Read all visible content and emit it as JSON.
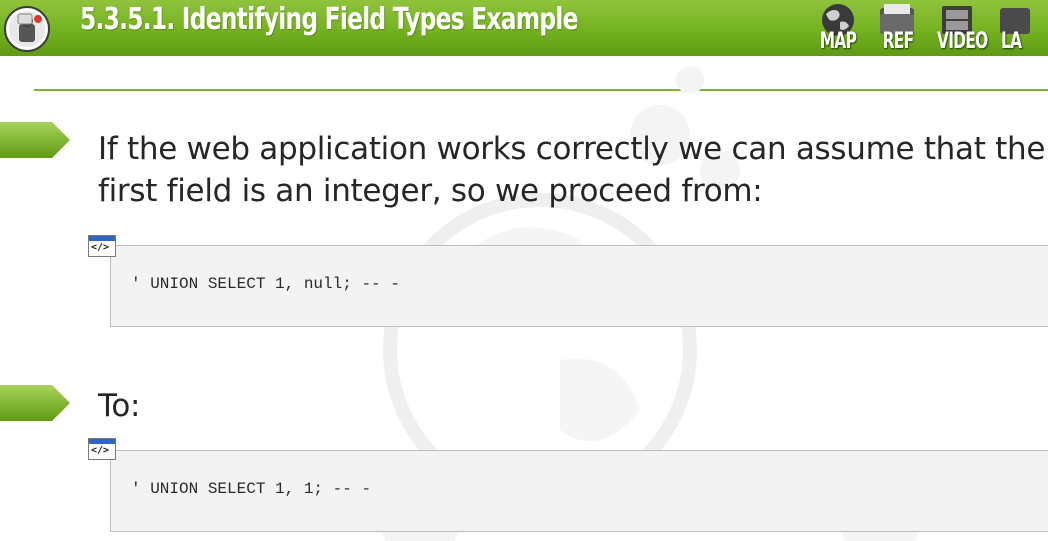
{
  "header": {
    "title": "5.3.5.1. Identifying Field Types Example",
    "nav": [
      {
        "label": "MAP",
        "icon": "globe-icon"
      },
      {
        "label": "REF",
        "icon": "folder-icon"
      },
      {
        "label": "VIDEO",
        "icon": "film-icon"
      },
      {
        "label": "LA",
        "icon": "lab-icon"
      }
    ]
  },
  "content": {
    "paragraph1_line1": "If the web application works correctly we can assume that the",
    "paragraph1_line2": "first field is an integer, so we proceed from:",
    "code1": "' UNION SELECT 1, null; -- -",
    "paragraph2": "To:",
    "code2": "' UNION SELECT 1, 1; -- -",
    "code_icon_label": "</>"
  },
  "colors": {
    "header_green": "#73b21f",
    "accent_green": "#7ab52a",
    "code_icon_blue": "#2f66c6",
    "code_bg": "#f3f3f3"
  }
}
